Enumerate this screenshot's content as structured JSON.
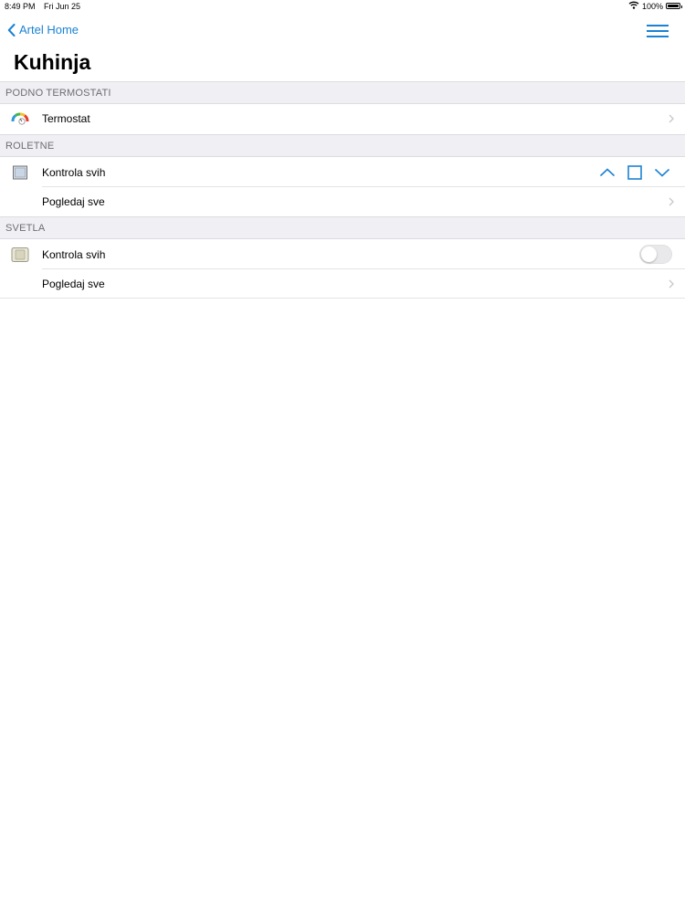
{
  "status_bar": {
    "time": "8:49 PM",
    "date": "Fri Jun 25",
    "battery_text": "100%",
    "battery_level": 1.0,
    "icons": [
      "wifi-icon",
      "battery-icon"
    ]
  },
  "nav": {
    "back_label": "Artel Home",
    "menu_icon": "hamburger-menu-icon",
    "accent_color": "#1a82d4"
  },
  "page": {
    "title": "Kuhinja"
  },
  "sections": {
    "floor_heating": {
      "header": "PODNO TERMOSTATI",
      "rows": [
        {
          "label": "Termostat",
          "icon": "thermostat-gauge-icon"
        }
      ]
    },
    "shutters": {
      "header": "ROLETNE",
      "rows": [
        {
          "label": "Kontrola svih",
          "icon": "shutter-window-icon",
          "controls": [
            "up-arrow-icon",
            "stop-square-icon",
            "down-arrow-icon"
          ]
        },
        {
          "label": "Pogledaj sve"
        }
      ]
    },
    "lights": {
      "header": "SVETLA",
      "rows": [
        {
          "label": "Kontrola svih",
          "icon": "light-switch-icon",
          "toggle_on": false
        },
        {
          "label": "Pogledaj sve"
        }
      ]
    }
  },
  "colors": {
    "section_background": "#efeff4",
    "section_text": "#6d6d72",
    "accent": "#1a82d4"
  }
}
